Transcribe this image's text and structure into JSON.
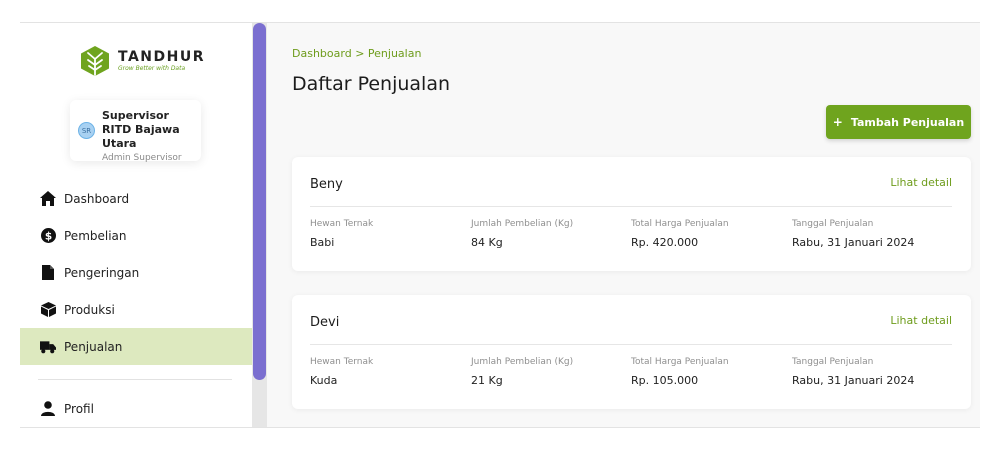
{
  "brand": {
    "name": "TANDHUR",
    "tagline": "Grow Better with Data",
    "accent": "#6fa41e"
  },
  "user": {
    "initials": "SR",
    "name": "Supervisor RITD Bajawa Utara",
    "role": "Admin Supervisor"
  },
  "sidebar": {
    "items": [
      {
        "label": "Dashboard",
        "icon": "home-icon"
      },
      {
        "label": "Pembelian",
        "icon": "dollar-circle-icon"
      },
      {
        "label": "Pengeringan",
        "icon": "file-icon"
      },
      {
        "label": "Produksi",
        "icon": "box-icon"
      },
      {
        "label": "Penjualan",
        "icon": "truck-icon",
        "active": true
      }
    ],
    "profile_item": {
      "label": "Profil",
      "icon": "user-icon"
    }
  },
  "breadcrumb": {
    "root": "Dashboard",
    "separator": ">",
    "current": "Penjualan"
  },
  "page_title": "Daftar Penjualan",
  "add_button": {
    "plus": "+",
    "label": "Tambah Penjualan"
  },
  "columns": {
    "animal": "Hewan Ternak",
    "weight": "Jumlah Pembelian (Kg)",
    "price": "Total Harga Penjualan",
    "date": "Tanggal Penjualan"
  },
  "detail_link": "Lihat detail",
  "sales": [
    {
      "name": "Beny",
      "animal": "Babi",
      "weight": "84 Kg",
      "price": "Rp. 420.000",
      "date": "Rabu, 31 Januari 2024"
    },
    {
      "name": "Devi",
      "animal": "Kuda",
      "weight": "21 Kg",
      "price": "Rp. 105.000",
      "date": "Rabu, 31 Januari 2024"
    }
  ]
}
